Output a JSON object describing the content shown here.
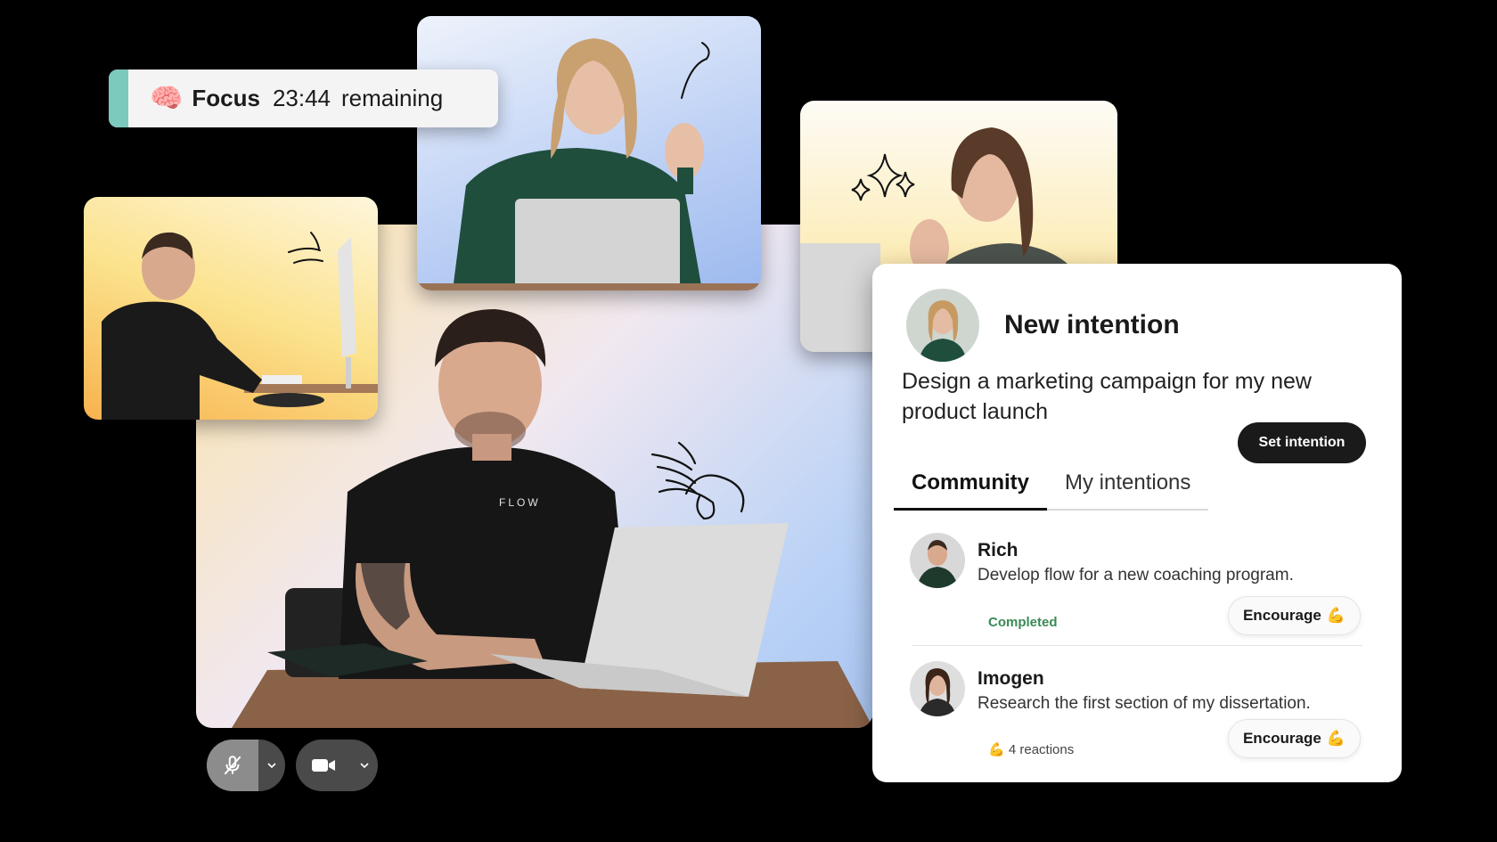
{
  "focus": {
    "icon": "brain-icon",
    "label": "Focus",
    "time": "23:44",
    "suffix": "remaining",
    "accent": "#7cc9bd"
  },
  "video": {
    "shirt_text": "FLOW"
  },
  "controls": {
    "mic_icon": "mic-muted-icon",
    "camera_icon": "camera-icon",
    "chevron_icon": "chevron-down-icon"
  },
  "panel": {
    "title": "New intention",
    "intention_text": "Design a marketing campaign for my new product launch",
    "set_button": "Set intention",
    "tabs": [
      {
        "label": "Community",
        "active": true
      },
      {
        "label": "My intentions",
        "active": false
      }
    ],
    "items": [
      {
        "name": "Rich",
        "description": "Develop flow for a new coaching program.",
        "status": "Completed",
        "button": "Encourage",
        "emoji": "💪"
      },
      {
        "name": "Imogen",
        "description": "Research the first section of my dissertation.",
        "reactions": "4 reactions",
        "reaction_emoji": "💪",
        "button": "Encourage",
        "emoji": "💪"
      }
    ]
  }
}
